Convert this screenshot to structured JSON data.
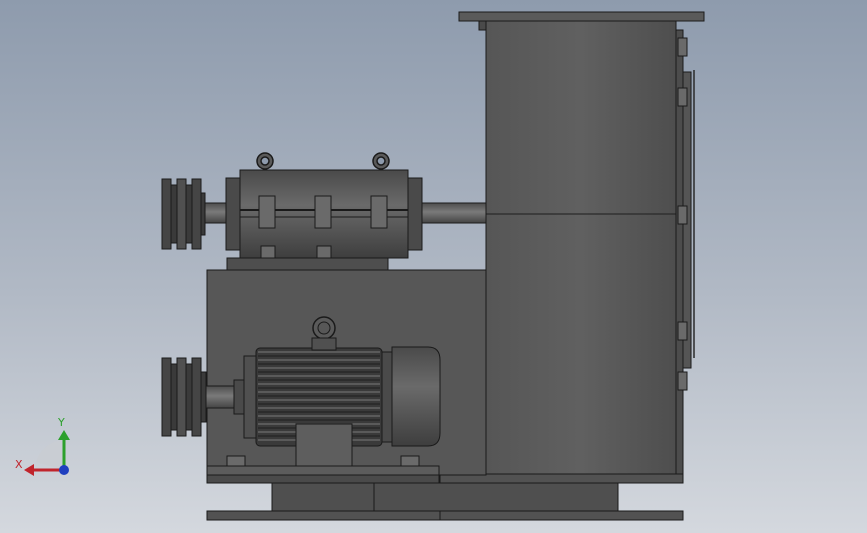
{
  "viewport": {
    "background_top": "#8e9bad",
    "background_bottom": "#d4d8de"
  },
  "model": {
    "body_color": "#585858",
    "dark_color": "#2e2e2e",
    "edge_color": "#1a1a1a"
  },
  "triad": {
    "x_label": "X",
    "y_label": "Y",
    "x_color": "#c0242c",
    "y_color": "#2ca02c",
    "z_color": "#1f3fbf"
  }
}
